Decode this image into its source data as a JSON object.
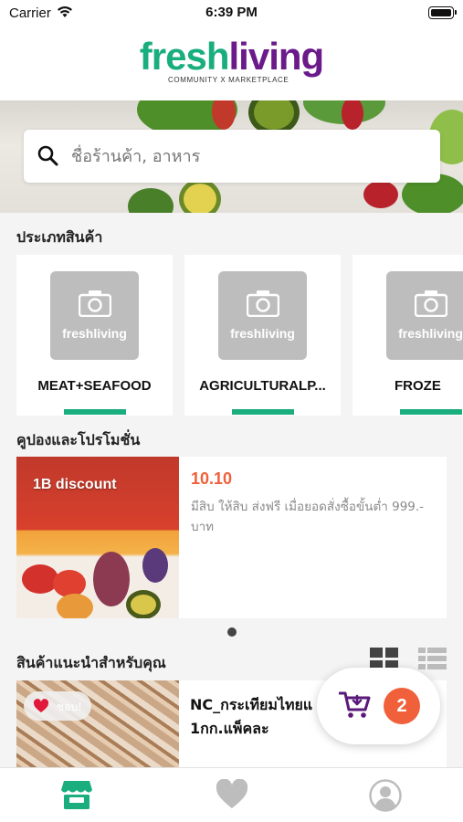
{
  "status_bar": {
    "carrier": "Carrier",
    "time": "6:39 PM"
  },
  "header": {
    "logo_part1": "fresh",
    "logo_part2": "living",
    "tagline": "COMMUNITY X MARKETPLACE"
  },
  "search": {
    "placeholder": "ชื่อร้านค้า, อาหาร"
  },
  "categories": {
    "title": "ประเภทสินค้า",
    "items": [
      {
        "label": "MEAT+SEAFOOD",
        "thumb_text": "freshliving"
      },
      {
        "label": "AGRICULTURALP...",
        "thumb_text": "freshliving"
      },
      {
        "label": "FROZE",
        "thumb_text": "freshliving"
      }
    ]
  },
  "coupons": {
    "title": "คูปองและโปรโมชั่น",
    "item": {
      "discount_label": "1B discount",
      "title": "10.10",
      "description": "มีสิบ ให้สิบ ส่งฟรี เมื่อยอดสั่งซื้อขั้นต่ำ 999.- บาท"
    },
    "page_count": 1,
    "active_page": 1
  },
  "recommended": {
    "title": "สินค้าแนะนำสำหรับคุณ",
    "product": {
      "name": "NC_กระเทียมไทยแ 1กก.แพ็คละ",
      "name_line1": "NC_กระเทียมไทยแ",
      "name_line2": "1กก.แพ็คละ",
      "favorite_label": "ชอบ!"
    }
  },
  "cart": {
    "count": "2"
  },
  "colors": {
    "brand_green": "#1aae7e",
    "brand_purple": "#6b1a8a",
    "accent_orange": "#f0603a"
  },
  "tabs": [
    {
      "name": "shop",
      "icon": "store-icon",
      "active": true
    },
    {
      "name": "favorites",
      "icon": "heart-icon",
      "active": false
    },
    {
      "name": "profile",
      "icon": "user-icon",
      "active": false
    }
  ]
}
